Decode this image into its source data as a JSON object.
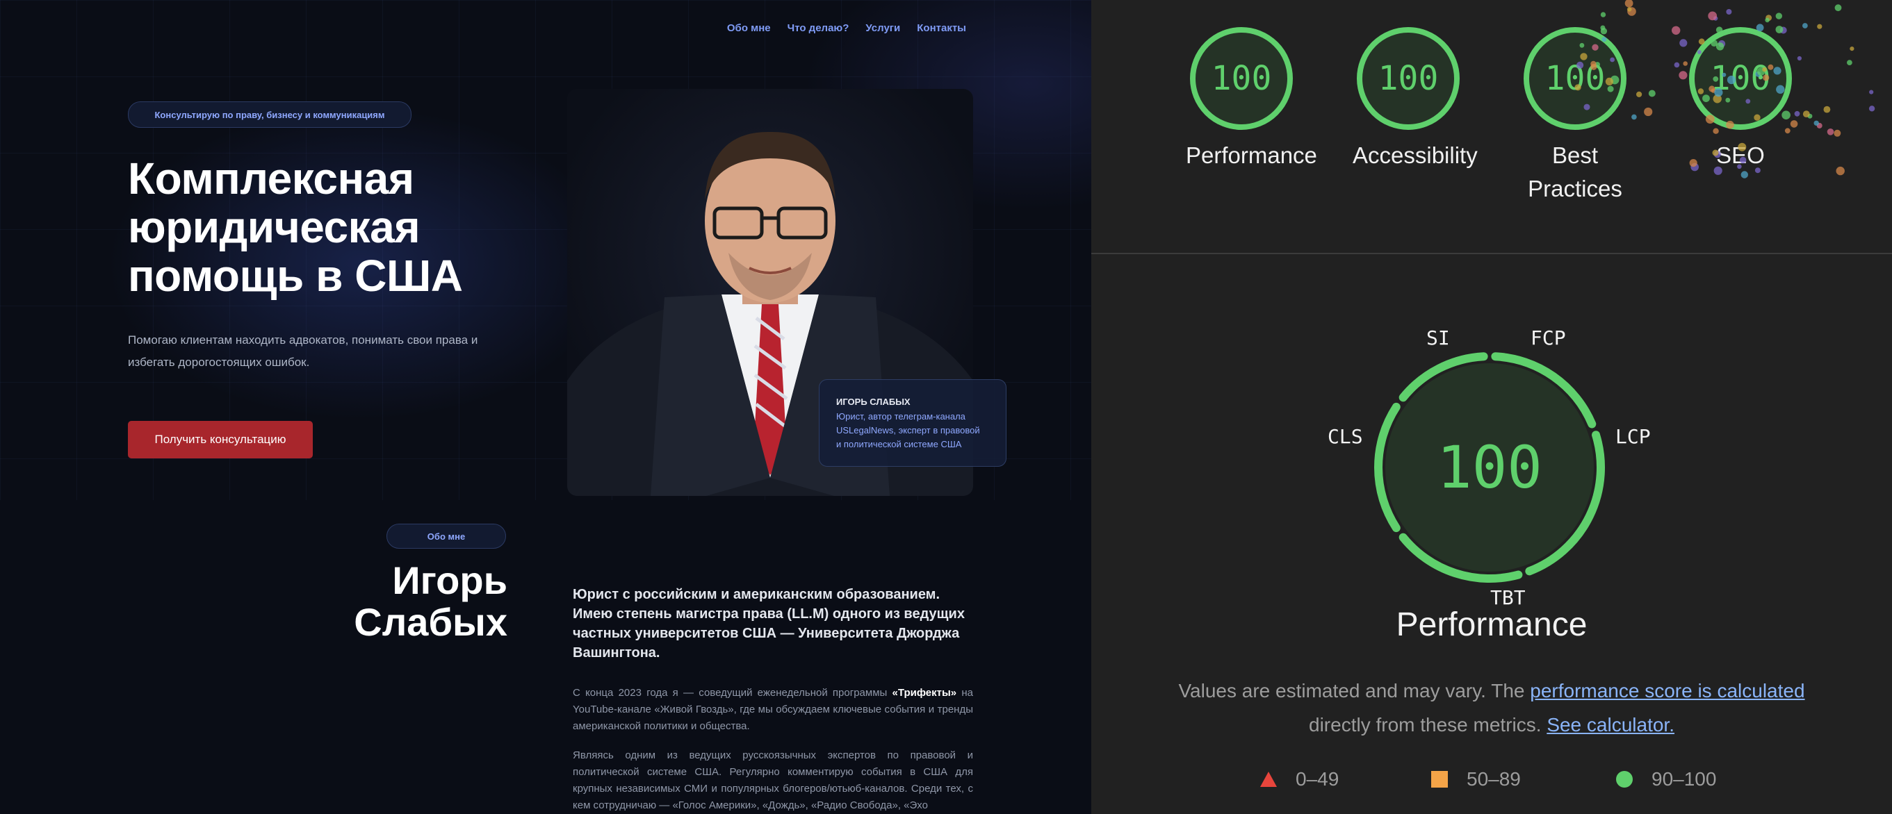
{
  "site": {
    "nav": [
      "Обо мне",
      "Что делаю?",
      "Услуги",
      "Контакты"
    ],
    "hero_pill": "Консультирую по праву, бизнесу и коммуникациям",
    "hero_title_lines": [
      "Комплексная",
      "юридическая",
      "помощь в США"
    ],
    "hero_subtitle_lines": [
      "Помогаю клиентам находить адвокатов, понимать свои права и",
      "избегать дорогостоящих ошибок."
    ],
    "cta": "Получить консультацию",
    "caption_name": "ИГОРЬ СЛАБЫХ",
    "caption_desc_lines": [
      "Юрист, автор телеграм-канала",
      "USLegalNews, эксперт в правовой",
      "и политической системе США"
    ],
    "about_pill": "Обо мне",
    "about_name_lines": [
      "Игорь",
      "Слабых"
    ],
    "about_lead": "Юрист с российским и американским образованием. Имею степень магистра права (LL.M) одного из ведущих частных университетов США — Университета Джорджа Вашингтона.",
    "para1_before": "С конца 2023 года я — соведущий еженедельной программы ",
    "para1_bold": "«Трифекты»",
    "para1_after": " на YouTube-канале «Живой Гвоздь», где мы обсуждаем ключевые события и тренды американской политики и общества.",
    "para2": "Являясь одним из ведущих русскоязычных экспертов по правовой и политической системе США. Регулярно комментирую события в США для крупных независимых СМИ и популярных блогеров/ютьюб-каналов. Среди тех, с кем сотрудничаю — «Голос Америки», «Дождь», «Радио Свобода», «Эхо"
  },
  "lighthouse": {
    "gauges": [
      {
        "label": "Performance",
        "score": "100"
      },
      {
        "label": "Accessibility",
        "score": "100"
      },
      {
        "label": "Best Practices",
        "score": "100"
      },
      {
        "label": "SEO",
        "score": "100"
      }
    ],
    "performance_score": "100",
    "metric_labels": {
      "si": "SI",
      "fcp": "FCP",
      "lcp": "LCP",
      "cls": "CLS",
      "tbt": "TBT"
    },
    "performance_title": "Performance",
    "note_text1": "Values are estimated and may vary. The ",
    "note_link1": "performance score is calculated",
    "note_text2": "directly from these metrics. ",
    "note_link2": "See calculator.",
    "legend": [
      "0–49",
      "50–89",
      "90–100"
    ],
    "colors": {
      "pass": "#5fd06c",
      "average": "#f4a448",
      "fail": "#e8453c",
      "link": "#8ab4f8"
    }
  }
}
